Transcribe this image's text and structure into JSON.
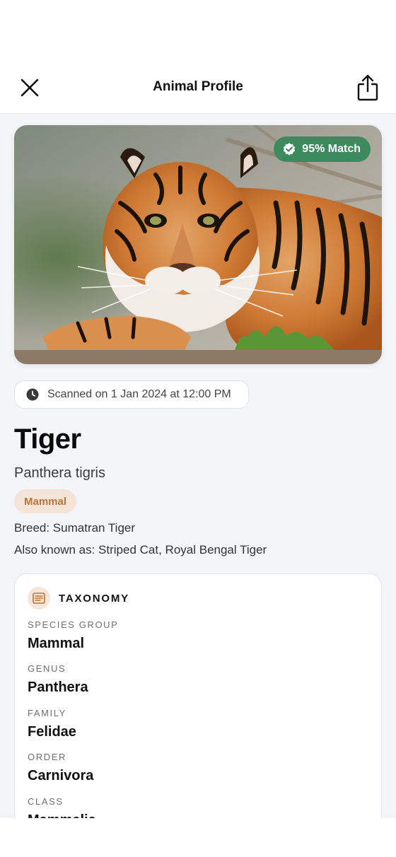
{
  "header": {
    "title": "Animal Profile",
    "close_icon": "close-icon",
    "share_icon": "share-icon"
  },
  "hero": {
    "image_subject": "tiger lying on a log",
    "match_badge": "95% Match",
    "match_icon": "verified-check-icon",
    "match_color": "#3d8a5e"
  },
  "scan": {
    "icon": "clock-icon",
    "text": "Scanned on 1 Jan 2024 at 12:00 PM"
  },
  "animal": {
    "name": "Tiger",
    "scientific_name": "Panthera tigris",
    "class_chip": "Mammal",
    "breed": "Breed: Sumatran Tiger",
    "also_known_as": "Also known as: Striped Cat, Royal Bengal Tiger"
  },
  "taxonomy": {
    "title": "TAXONOMY",
    "icon": "document-list-icon",
    "rows": [
      {
        "label": "SPECIES GROUP",
        "value": "Mammal"
      },
      {
        "label": "GENUS",
        "value": "Panthera"
      },
      {
        "label": "FAMILY",
        "value": "Felidae"
      },
      {
        "label": "ORDER",
        "value": "Carnivora"
      },
      {
        "label": "CLASS",
        "value": "Mammalia"
      }
    ]
  },
  "colors": {
    "accent_orange": "#b8743a",
    "chip_bg": "#f4e4d8",
    "page_bg": "#f3f5f8"
  }
}
